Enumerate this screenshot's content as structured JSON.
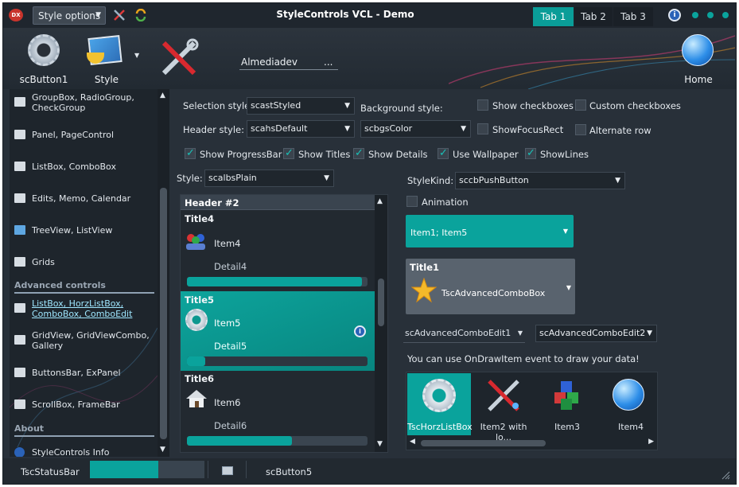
{
  "window": {
    "title": "StyleControls VCL - Demo",
    "style_button": "Style options"
  },
  "tabs": [
    {
      "label": "Tab 1",
      "active": true
    },
    {
      "label": "Tab 2",
      "active": false
    },
    {
      "label": "Tab 3",
      "active": false
    }
  ],
  "ribbon": {
    "button1": "scButton1",
    "style": "Style",
    "edit_value": "Almediadev",
    "edit_dots": "...",
    "home": "Home"
  },
  "sidebar": {
    "items_top": [
      {
        "label": "GroupBox, RadioGroup, CheckGroup",
        "icon": "groupbox-icon"
      },
      {
        "label": "Panel, PageControl",
        "icon": "panel-icon"
      },
      {
        "label": "ListBox, ComboBox",
        "icon": "listbox-icon"
      },
      {
        "label": "Edits, Memo, Calendar",
        "icon": "edit-icon"
      },
      {
        "label": "TreeView, ListView",
        "icon": "treeview-icon"
      },
      {
        "label": "Grids",
        "icon": "grid-icon"
      }
    ],
    "section_advanced": "Advanced controls",
    "items_adv": [
      {
        "label": "ListBox, HorzListBox, ComboBox, ComboEdit",
        "icon": "listbox-icon"
      },
      {
        "label": "GridView, GridViewCombo, Gallery",
        "icon": "gridview-icon"
      },
      {
        "label": "ButtonsBar, ExPanel",
        "icon": "buttonsbar-icon"
      },
      {
        "label": "ScrollBox, FrameBar",
        "icon": "scrollbox-icon"
      }
    ],
    "section_about": "About",
    "items_about": [
      {
        "label": "StyleControls Info",
        "icon": "info-icon"
      }
    ]
  },
  "options": {
    "selection_style_label": "Selection style:",
    "selection_style": "scastStyled",
    "background_style_label": "Background style:",
    "header_style_label": "Header style:",
    "header_style": "scahsDefault",
    "bg_style": "scbgsColor",
    "show_checkboxes": "Show checkboxes",
    "custom_checkboxes": "Custom checkboxes",
    "show_focus_rect": "ShowFocusRect",
    "alternate_row": "Alternate row",
    "show_progressbar": "Show ProgressBar",
    "show_titles": "Show Titles",
    "show_details": "Show Details",
    "use_wallpaper": "Use Wallpaper",
    "show_lines": "ShowLines",
    "style_label": "Style:",
    "style_value": "scalbsPlain"
  },
  "listbox": {
    "header": "Header #2",
    "items": [
      {
        "title": "Title4",
        "item": "Item4",
        "detail": "Detail4",
        "progress": 0.97,
        "selected": false
      },
      {
        "title": "Title5",
        "item": "Item5",
        "detail": "Detail5",
        "progress": 0.1,
        "selected": true
      },
      {
        "title": "Title6",
        "item": "Item6",
        "detail": "Detail6",
        "progress": 0.58,
        "selected": false
      }
    ]
  },
  "right": {
    "stylekind_label": "StyleKind:",
    "stylekind": "sccbPushButton",
    "animation": "Animation",
    "combo1": "Item1; Item5",
    "combo2_title": "Title1",
    "combo2_value": "TscAdvancedComboBox",
    "comboedit1": "scAdvancedComboEdit1",
    "comboedit2": "scAdvancedComboEdit2",
    "hint": "You can use OnDrawItem event to draw your data!",
    "horz_items": [
      "TscHorzListBox",
      "Item2 with lo...",
      "Item3",
      "Item4"
    ]
  },
  "status": {
    "panel1": "TscStatusBar",
    "progress": 0.6,
    "button": "scButton5"
  },
  "colors": {
    "accent": "#0a9d98",
    "bg": "#283039",
    "panel": "#1e252c"
  }
}
